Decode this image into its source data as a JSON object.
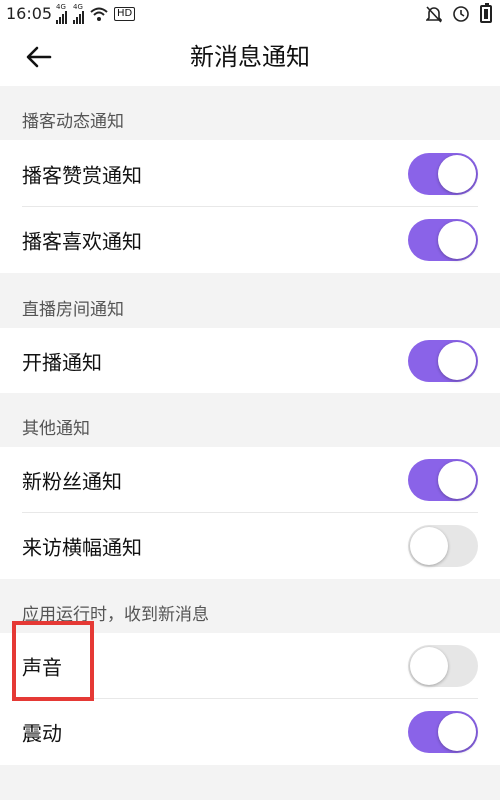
{
  "status_bar": {
    "time": "16:05",
    "network_1": "4G",
    "network_2": "4G",
    "hd_label": "HD"
  },
  "header": {
    "title": "新消息通知"
  },
  "sections": [
    {
      "title": "播客动态通知",
      "items": [
        {
          "label": "播客赞赏通知",
          "on": true
        },
        {
          "label": "播客喜欢通知",
          "on": true
        }
      ]
    },
    {
      "title": "直播房间通知",
      "items": [
        {
          "label": "开播通知",
          "on": true
        }
      ]
    },
    {
      "title": "其他通知",
      "items": [
        {
          "label": "新粉丝通知",
          "on": true
        },
        {
          "label": "来访横幅通知",
          "on": false
        }
      ]
    },
    {
      "title": "应用运行时，收到新消息",
      "items": [
        {
          "label": "声音",
          "on": false
        },
        {
          "label": "震动",
          "on": true
        }
      ]
    }
  ],
  "colors": {
    "toggle_on": "#8a63e8",
    "toggle_off": "#e6e6e6",
    "highlight": "#e53935"
  }
}
